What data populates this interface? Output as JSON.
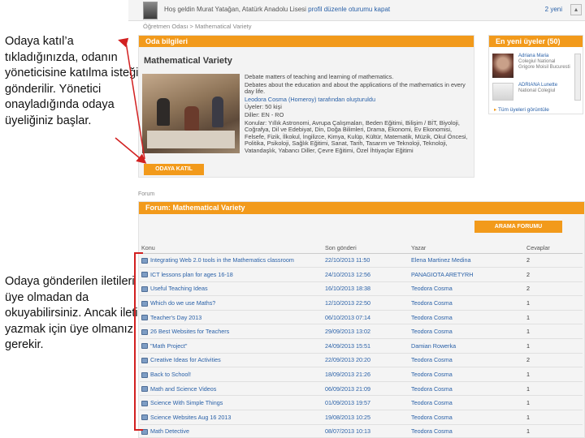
{
  "annotations": {
    "top_note": "Odaya katıl’a tıkladığınızda, odanın yöneticisine katılma isteği gönderilir. Yönetici onayladığında odaya üyeliğiniz başlar.",
    "bottom_note": "Odaya gönderilen iletileri üye olmadan da okuyabilirsiniz. Ancak ileti yazmak için üye olmanız gerekir."
  },
  "topbar": {
    "welcome": "Hoş geldin Murat Yatağan, Atatürk Anadolu Lisesi",
    "links": "profil düzenle  oturumu kapat",
    "right": "2 yeni"
  },
  "breadcrumb": "Öğretmen Odası > Mathematical Variety",
  "room": {
    "section_title": "Oda bilgileri",
    "name": "Mathematical Variety",
    "description": [
      "Debate matters of teaching and learning of mathematics.",
      "Debates about the education and about the applications of the mathematics in every day life.",
      "Leodora Cosma (Homeroy) tarafından oluşturuldu",
      "Üyeler: 50 kişi",
      "Diller: EN - RO",
      "Konular: Yıllık Astronomi, Avrupa Çalışmaları, Beden Eğitimi, Bilişim / BİT, Biyoloji, Coğrafya, Dil ve Edebiyat, Din, Doğa Bilimleri, Drama, Ekonomi, Ev Ekonomisi, Felsefe, Fizik, İlkokul, İngilizce, Kimya, Kulüp, Kültür, Matematik, Müzik, Okul Öncesi, Politika, Psikoloji, Sağlık Eğitimi, Sanat, Tarih, Tasarım ve Teknoloji, Teknoloji, Vatandaşlık, Yabancı Diller, Çevre Eğitimi, Özel İhtiyaçlar Eğitimi"
    ],
    "join_label": "ODAYA KATIL"
  },
  "members": {
    "section_title": "En yeni üyeler (50)",
    "items": [
      {
        "name": "Adriana Maria",
        "school": "Colegiul National Grigore Moisil Bucuresti"
      },
      {
        "name": "ADRIANA Lunette",
        "school": "National Colegiul"
      }
    ],
    "all_link": "Tüm üyeleri görüntüle"
  },
  "forum": {
    "label": "Forum",
    "section_title": "Forum: Mathematical Variety",
    "search_label": "ARAMA FORUMU",
    "columns": [
      "Konu",
      "Son gönderi",
      "Yazar",
      "Cevaplar"
    ],
    "rows": [
      {
        "topic": "Integrating Web 2.0 tools in the Mathematics classroom",
        "last": "22/10/2013 11:50",
        "author": "Elena Martinez Medina",
        "replies": "2"
      },
      {
        "topic": "ICT lessons plan for ages 16-18",
        "last": "24/10/2013 12:56",
        "author": "PANAGIOTA ARETYRH",
        "replies": "2"
      },
      {
        "topic": "Useful Teaching Ideas",
        "last": "16/10/2013 18:38",
        "author": "Teodora Cosma",
        "replies": "2"
      },
      {
        "topic": "Which do we use Maths?",
        "last": "12/10/2013 22:50",
        "author": "Teodora Cosma",
        "replies": "1"
      },
      {
        "topic": "Teacher's Day 2013",
        "last": "06/10/2013 07:14",
        "author": "Teodora Cosma",
        "replies": "1"
      },
      {
        "topic": "26 Best Websites for Teachers",
        "last": "29/09/2013 13:02",
        "author": "Teodora Cosma",
        "replies": "1"
      },
      {
        "topic": "\"Math Project\"",
        "last": "24/09/2013 15:51",
        "author": "Damian Rowerka",
        "replies": "1"
      },
      {
        "topic": "Creative Ideas for Activities",
        "last": "22/09/2013 20:20",
        "author": "Teodora Cosma",
        "replies": "2"
      },
      {
        "topic": "Back to School!",
        "last": "18/09/2013 21:26",
        "author": "Teodora Cosma",
        "replies": "1"
      },
      {
        "topic": "Math and Science Videos",
        "last": "06/09/2013 21:09",
        "author": "Teodora Cosma",
        "replies": "1"
      },
      {
        "topic": "Science With Simple Things",
        "last": "01/09/2013 19:57",
        "author": "Teodora Cosma",
        "replies": "1"
      },
      {
        "topic": "Science Websites Aug 16 2013",
        "last": "19/08/2013 10:25",
        "author": "Teodora Cosma",
        "replies": "1"
      },
      {
        "topic": "Math Detective",
        "last": "08/07/2013 10:13",
        "author": "Teodora Cosma",
        "replies": "1"
      }
    ]
  },
  "colors": {
    "accent_orange": "#f29a1b",
    "link_blue": "#2a61a8",
    "annotation_red": "#d22020"
  }
}
